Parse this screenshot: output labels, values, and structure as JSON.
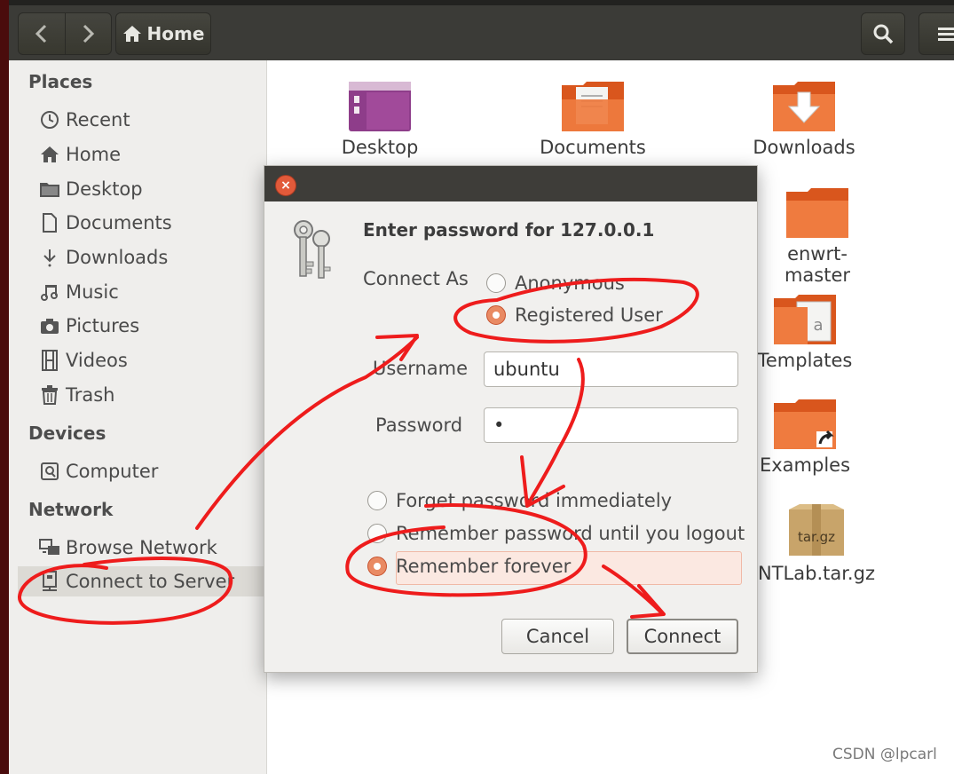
{
  "toolbar": {
    "location": "Home"
  },
  "sidebar": {
    "sections": {
      "places": "Places",
      "devices": "Devices",
      "network": "Network"
    },
    "places": [
      "Recent",
      "Home",
      "Desktop",
      "Documents",
      "Downloads",
      "Music",
      "Pictures",
      "Videos",
      "Trash"
    ],
    "devices": [
      "Computer"
    ],
    "network": [
      "Browse Network",
      "Connect to Server"
    ]
  },
  "files": [
    {
      "name": "Desktop",
      "icon": "desktop-folder-icon"
    },
    {
      "name": "Documents",
      "icon": "documents-folder-icon"
    },
    {
      "name": "Downloads",
      "icon": "downloads-folder-icon"
    },
    {
      "name": "enwrt-master",
      "icon": "folder-icon"
    },
    {
      "name": "Templates",
      "icon": "templates-folder-icon"
    },
    {
      "name": "Examples",
      "icon": "examples-folder-icon"
    },
    {
      "name": "NTLab.tar.gz",
      "icon": "archive-icon",
      "badge": "tar.gz"
    }
  ],
  "dialog": {
    "heading": "Enter password for 127.0.0.1",
    "connect_as_label": "Connect As",
    "connect_as_options": [
      "Anonymous",
      "Registered User"
    ],
    "connect_as_selected": "Registered User",
    "username_label": "Username",
    "username_value": "ubuntu",
    "password_label": "Password",
    "password_value": "•",
    "remember_options": [
      "Forget password immediately",
      "Remember password until you logout",
      "Remember forever"
    ],
    "remember_selected": "Remember forever",
    "cancel_label": "Cancel",
    "connect_label": "Connect"
  },
  "watermark": "CSDN @lpcarl",
  "colors": {
    "accent": "#e95420",
    "annotation": "#ee1c1c",
    "toolbar": "#3b3b37",
    "sidebar": "#efeeec"
  }
}
